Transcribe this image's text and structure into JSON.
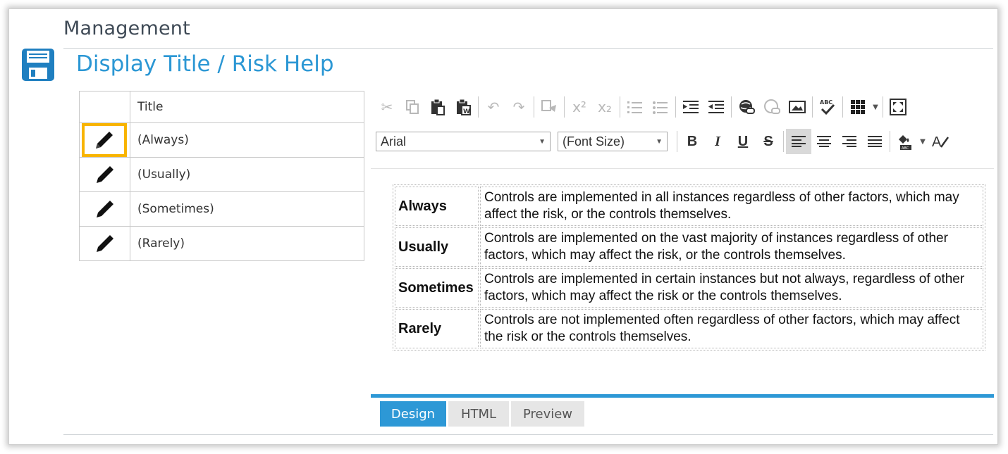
{
  "header": {
    "section_title": "Management"
  },
  "page": {
    "title": "Display Title / Risk Help"
  },
  "grid": {
    "column_header": "Title",
    "rows": [
      {
        "title": "(Always)",
        "selected": true
      },
      {
        "title": "(Usually)",
        "selected": false
      },
      {
        "title": "(Sometimes)",
        "selected": false
      },
      {
        "title": "(Rarely)",
        "selected": false
      }
    ]
  },
  "editor": {
    "font_family_value": "Arial",
    "font_size_value": "(Font Size)",
    "superscript_label": "x²",
    "subscript_label": "x₂",
    "spell_label": "ABC",
    "bold_label": "B",
    "italic_label": "I",
    "underline_label": "U",
    "strike_label": "S",
    "content_rows": [
      {
        "level": "Always",
        "description": "Controls are implemented in all instances regardless of other factors, which may affect the risk, or the controls themselves."
      },
      {
        "level": "Usually",
        "description": "Controls are implemented on the vast majority of instances regardless of other factors, which may affect the risk, or the controls themselves."
      },
      {
        "level": "Sometimes",
        "description": "Controls are implemented in certain instances but not always, regardless of other factors, which may affect the risk or the controls themselves."
      },
      {
        "level": "Rarely",
        "description": "Controls are not implemented often regardless of other factors, which may affect the risk or the controls themselves."
      }
    ],
    "tabs": [
      {
        "label": "Design",
        "active": true
      },
      {
        "label": "HTML",
        "active": false
      },
      {
        "label": "Preview",
        "active": false
      }
    ]
  },
  "colors": {
    "accent": "#2d98d6",
    "selection": "#f8b400",
    "heading": "#3f4a56"
  }
}
